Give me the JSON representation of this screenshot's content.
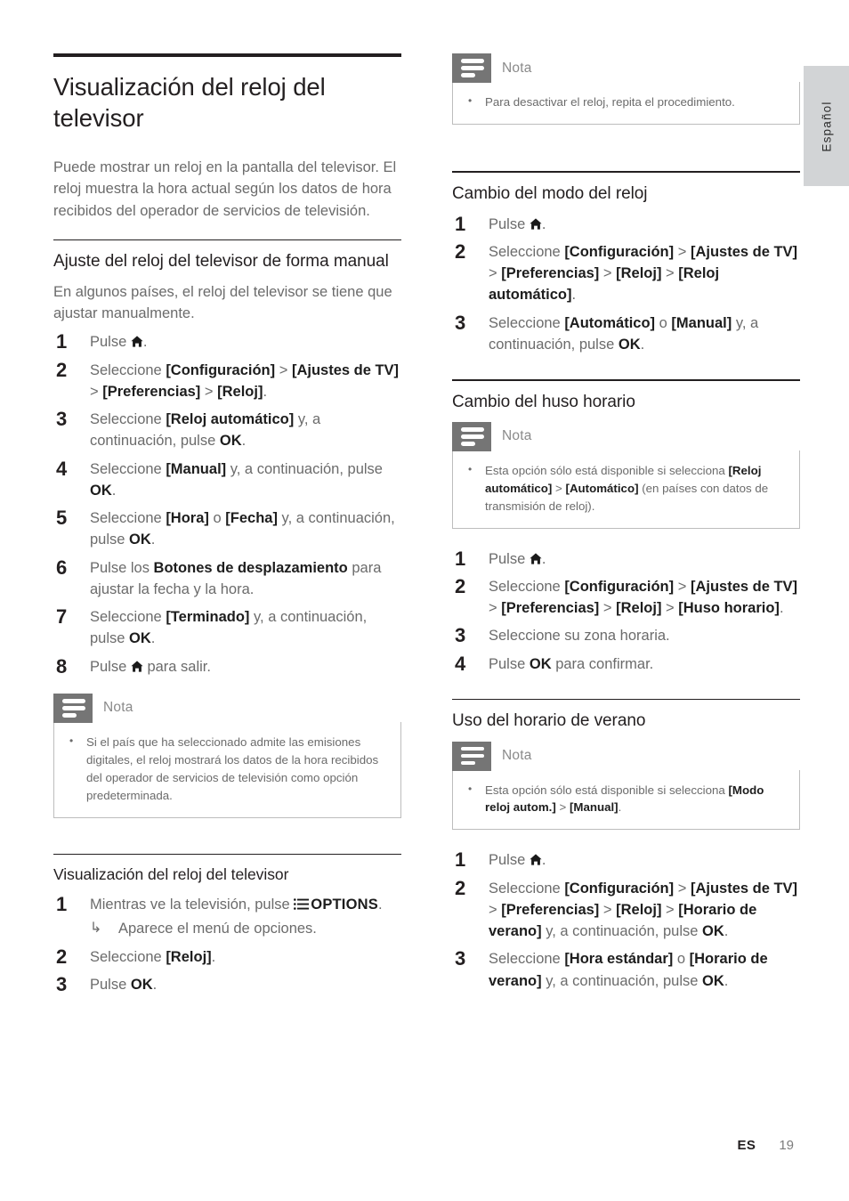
{
  "language_tab": {
    "label": "Español"
  },
  "footer": {
    "lang_code": "ES",
    "page_number": "19"
  },
  "icons": {
    "home": "home-icon",
    "options": "options-list-icon",
    "note": "note-lines-icon",
    "result_arrow": "↳"
  },
  "left_column": {
    "title": "Visualización del reloj del televisor",
    "intro": "Puede mostrar un reloj en la pantalla del televisor. El reloj muestra la hora actual según los datos de hora recibidos del operador de servicios de televisión.",
    "section_manual": {
      "heading": "Ajuste del reloj del televisor de forma manual",
      "intro": "En algunos países, el reloj del televisor se tiene que ajustar manualmente.",
      "steps": [
        {
          "n": "1",
          "pre": "Pulse ",
          "icon": "home",
          "post": "."
        },
        {
          "n": "2",
          "html": "Seleccione <b>[Configuración]</b> &gt; <b>[Ajustes de TV]</b> &gt; <b>[Preferencias]</b> &gt; <b>[Reloj]</b>."
        },
        {
          "n": "3",
          "html": "Seleccione <b>[Reloj automático]</b> y, a continuación, pulse <b>OK</b>."
        },
        {
          "n": "4",
          "html": "Seleccione <b>[Manual]</b> y, a continuación, pulse <b>OK</b>."
        },
        {
          "n": "5",
          "html": "Seleccione <b>[Hora]</b> o <b>[Fecha]</b> y, a continuación, pulse <b>OK</b>."
        },
        {
          "n": "6",
          "html": "Pulse los <b>Botones de desplazamiento</b> para ajustar la fecha y la hora."
        },
        {
          "n": "7",
          "html": "Seleccione <b>[Terminado]</b> y, a continuación, pulse <b>OK</b>."
        },
        {
          "n": "8",
          "pre": "Pulse ",
          "icon": "home",
          "post": " para salir."
        }
      ]
    },
    "note_1": {
      "title": "Nota",
      "items": [
        "Si el país que ha seleccionado admite las emisiones digitales, el reloj mostrará los datos de la hora recibidos del operador de servicios de televisión como opción predeterminada."
      ]
    },
    "section_display": {
      "heading": "Visualización del reloj del televisor",
      "steps": [
        {
          "n": "1",
          "html": "Mientras ve la televisión, pulse <span class=\"options-icon\"></span><span class=\"kbd\">OPTIONS</span>.",
          "result": "Aparece el menú de opciones."
        },
        {
          "n": "2",
          "html": "Seleccione <b>[Reloj]</b>."
        },
        {
          "n": "3",
          "html": "Pulse <b>OK</b>."
        }
      ]
    }
  },
  "right_column": {
    "note_top": {
      "title": "Nota",
      "items": [
        "Para desactivar el reloj, repita el procedimiento."
      ]
    },
    "section_mode": {
      "heading": "Cambio del modo del reloj",
      "steps": [
        {
          "n": "1",
          "pre": "Pulse ",
          "icon": "home",
          "post": "."
        },
        {
          "n": "2",
          "html": "Seleccione <b>[Configuración]</b> &gt; <b>[Ajustes de TV]</b> &gt; <b>[Preferencias]</b> &gt; <b>[Reloj]</b> &gt; <b>[Reloj automático]</b>."
        },
        {
          "n": "3",
          "html": "Seleccione <b>[Automático]</b> o <b>[Manual]</b> y, a continuación, pulse <b>OK</b>."
        }
      ]
    },
    "section_timezone": {
      "heading": "Cambio del huso horario",
      "note": {
        "title": "Nota",
        "items": [
          "Esta opción sólo está disponible si selecciona <b>[Reloj automático]</b> &gt; <b>[Automático]</b> (en países con datos de transmisión de reloj)."
        ]
      },
      "steps": [
        {
          "n": "1",
          "pre": "Pulse ",
          "icon": "home",
          "post": "."
        },
        {
          "n": "2",
          "html": "Seleccione <b>[Configuración]</b> &gt; <b>[Ajustes de TV]</b> &gt; <b>[Preferencias]</b> &gt; <b>[Reloj]</b> &gt; <b>[Huso horario]</b>."
        },
        {
          "n": "3",
          "html": "Seleccione su zona horaria."
        },
        {
          "n": "4",
          "html": "Pulse <b>OK</b> para confirmar."
        }
      ]
    },
    "section_dst": {
      "heading": "Uso del horario de verano",
      "note": {
        "title": "Nota",
        "items": [
          "Esta opción sólo está disponible si selecciona <b>[Modo reloj autom.]</b> &gt; <b>[Manual]</b>."
        ]
      },
      "steps": [
        {
          "n": "1",
          "pre": "Pulse ",
          "icon": "home",
          "post": "."
        },
        {
          "n": "2",
          "html": "Seleccione <b>[Configuración]</b> &gt; <b>[Ajustes de TV]</b> &gt; <b>[Preferencias]</b> &gt; <b>[Reloj]</b> &gt; <b>[Horario de verano]</b> y, a continuación, pulse <b>OK</b>."
        },
        {
          "n": "3",
          "html": "Seleccione <b>[Hora estándar]</b> o <b>[Horario de verano]</b> y, a continuación, pulse <b>OK</b>."
        }
      ]
    }
  }
}
